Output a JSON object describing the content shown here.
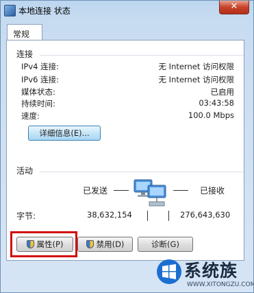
{
  "window": {
    "title": "本地连接 状态"
  },
  "tabs": [
    {
      "label": "常规"
    }
  ],
  "connection": {
    "heading": "连接",
    "rows": [
      {
        "label": "IPv4 连接:",
        "value": "无 Internet 访问权限"
      },
      {
        "label": "IPv6 连接:",
        "value": "无 Internet 访问权限"
      },
      {
        "label": "媒体状态:",
        "value": "已启用"
      },
      {
        "label": "持续时间:",
        "value": "03:43:58"
      },
      {
        "label": "速度:",
        "value": "100.0 Mbps"
      }
    ],
    "details_button": "详细信息(E)..."
  },
  "activity": {
    "heading": "活动",
    "sent_label": "已发送",
    "received_label": "已接收",
    "bytes_label": "字节:",
    "bytes_sent": "38,632,154",
    "bytes_received": "276,643,630"
  },
  "buttons": {
    "properties": "属性(P)",
    "disable": "禁用(D)",
    "diagnose": "诊断(G)"
  },
  "brand": {
    "name": "系统族",
    "url": "WWW.XITONGZU.COM"
  },
  "colors": {
    "highlight_box": "#d10a0a",
    "title_bar": "#bcd6ef"
  },
  "icons": {
    "window": "network-icon",
    "close": "close-icon",
    "activity": "network-computers-icon",
    "button_shield": "shield-icon"
  }
}
